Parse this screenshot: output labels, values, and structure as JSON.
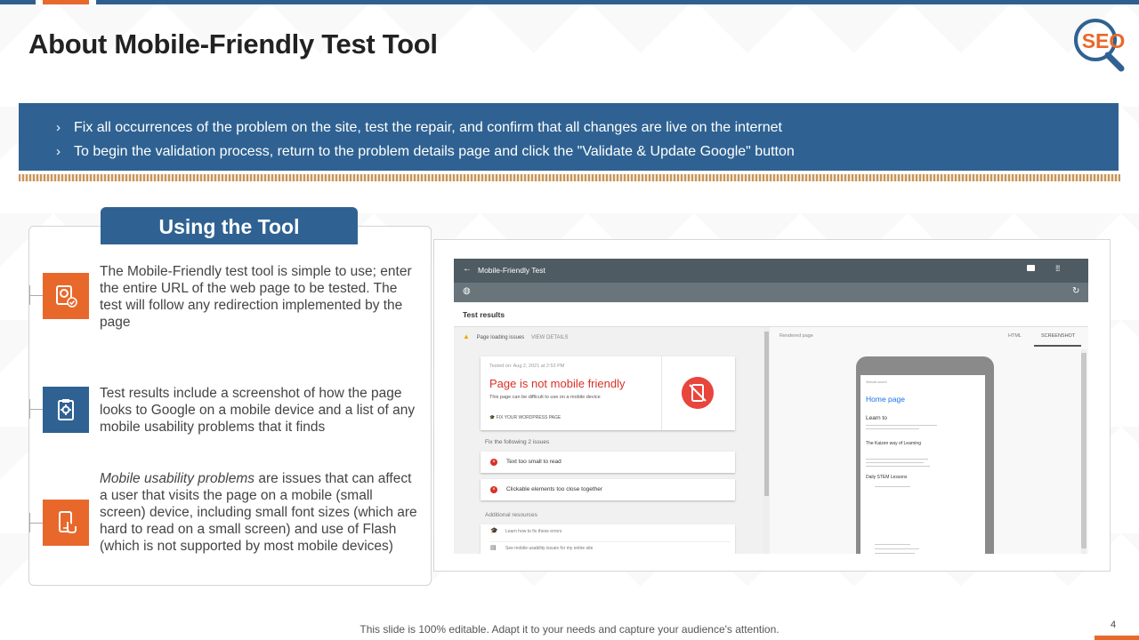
{
  "slide": {
    "title": "About Mobile-Friendly Test Tool",
    "logo_text": "SEO",
    "footer": "This slide is 100% editable. Adapt it to your needs and capture your audience's attention.",
    "page_number": "4"
  },
  "banner": {
    "bullets": [
      "Fix all occurrences of the problem on the site, test the repair, and confirm that all changes are live on the internet",
      "To begin the validation process, return to the problem details page and click the \"Validate & Update Google\" button"
    ]
  },
  "tool_section": {
    "header": "Using the Tool",
    "items": [
      {
        "icon": "laptop-check-icon",
        "text": "The Mobile-Friendly test tool is simple to use; enter the entire URL of the web page to be tested. The test will follow any redirection implemented by the page"
      },
      {
        "icon": "clipboard-gear-icon",
        "text": "Test results include a screenshot of how the page looks to Google on a mobile device and a list of any mobile usability problems that it finds"
      },
      {
        "icon": "phone-touch-icon",
        "emphasis": "Mobile usability problems",
        "text": " are issues that can affect a user that visits the page on a mobile (small screen) device, including small font sizes (which are hard to read on a small screen) and use of Flash (which is not supported by most mobile devices)"
      }
    ]
  },
  "screenshot": {
    "app_title": "Mobile-Friendly Test",
    "test_results": "Test results",
    "page_loading_issues": "Page loading issues",
    "view_details": "VIEW DETAILS",
    "tested_on": "Tested on: Aug 2, 2021 at 2:53 PM",
    "verdict": "Page is not mobile friendly",
    "verdict_sub": "This page can be difficult to use on a mobile device",
    "fix_link": "FIX YOUR WORDPRESS PAGE",
    "fix_label": "Fix the following 2 issues",
    "issues": [
      "Text too small to read",
      "Clickable elements too close together"
    ],
    "additional_resources": "Additional resources",
    "resources": [
      "Learn how to fix these errors",
      "See mobile usability issues for my entire site"
    ],
    "rendered_page": "Rendered page",
    "tab_html": "HTML",
    "tab_screenshot": "SCREENSHOT",
    "phone_nav": "Website search",
    "phone_home": "Home page",
    "phone_learn": "Learn to",
    "phone_kaizen": "The Kaizen way of Learning",
    "phone_daily": "Daily STEM Lessons"
  },
  "colors": {
    "accent_blue": "#2f6292",
    "accent_orange": "#e8682b",
    "error_red": "#d93025"
  }
}
